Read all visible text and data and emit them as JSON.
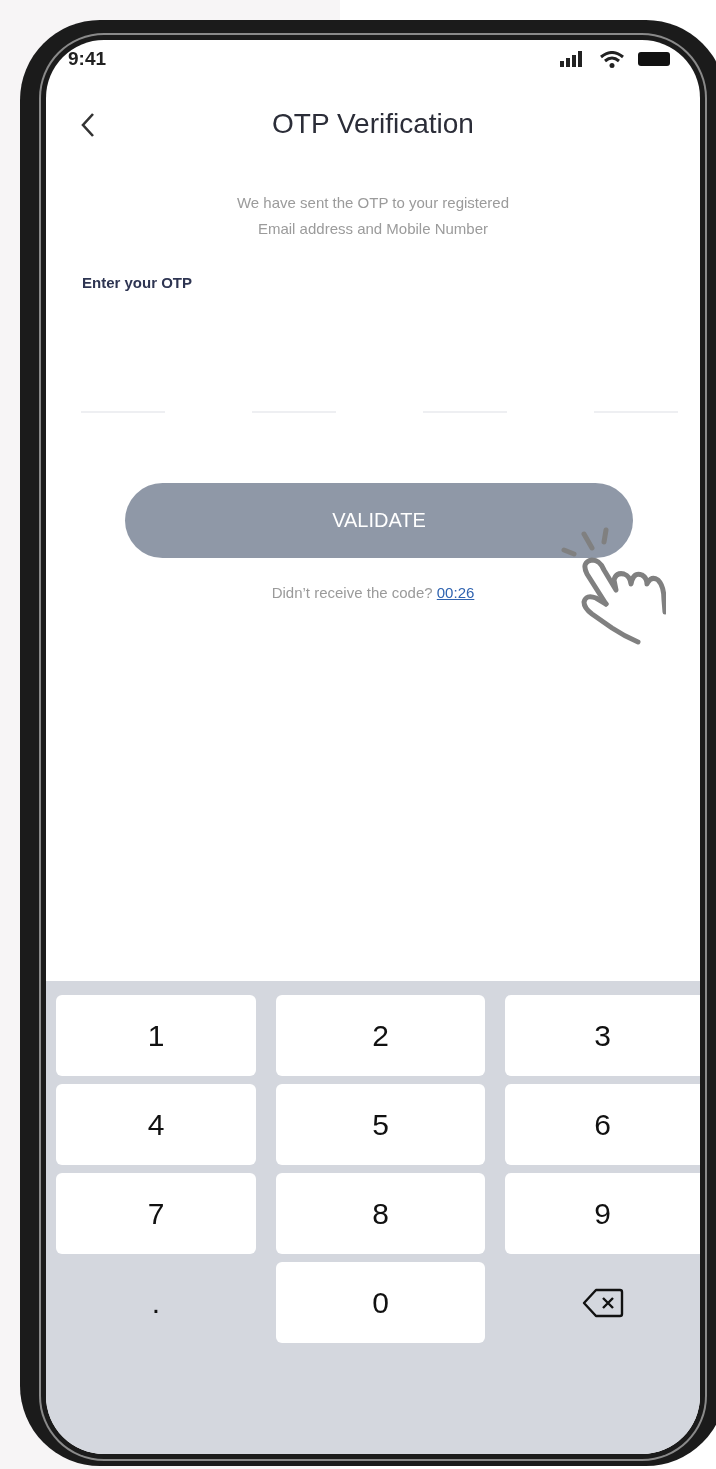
{
  "status_bar": {
    "time": "9:41"
  },
  "header": {
    "title": "OTP Verification"
  },
  "message_lines": [
    "We have sent the OTP to your registered",
    "Email address and Mobile Number"
  ],
  "otp": {
    "label": "Enter your OTP",
    "fields": [
      {
        "filled": false
      },
      {
        "filled": false
      },
      {
        "filled": false
      },
      {
        "filled": false
      }
    ]
  },
  "validate_button": {
    "label": "VALIDATE",
    "disabled": true
  },
  "resend": {
    "text": "Didn’t receive the code?",
    "timer": "00:26"
  },
  "keypad": [
    {
      "kind": "digit",
      "label": "1"
    },
    {
      "kind": "digit",
      "label": "2"
    },
    {
      "kind": "digit",
      "label": "3"
    },
    {
      "kind": "digit",
      "label": "4"
    },
    {
      "kind": "digit",
      "label": "5"
    },
    {
      "kind": "digit",
      "label": "6"
    },
    {
      "kind": "digit",
      "label": "7"
    },
    {
      "kind": "digit",
      "label": "8"
    },
    {
      "kind": "digit",
      "label": "9"
    },
    {
      "kind": "symbol",
      "label": "."
    },
    {
      "kind": "digit",
      "label": "0"
    },
    {
      "kind": "delete"
    }
  ]
}
